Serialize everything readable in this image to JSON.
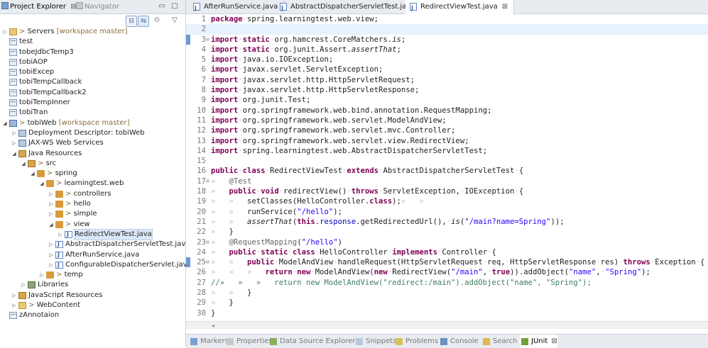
{
  "left_panel": {
    "tabs": [
      {
        "label": "Project Explorer",
        "close": "⊠",
        "active": true
      },
      {
        "label": "Navigator",
        "active": false
      }
    ],
    "tree": [
      {
        "indent": 0,
        "twisty": "▷",
        "icon": "server-icon",
        "prefix": "> ",
        "label": "Servers",
        "deco": "[workspace master]"
      },
      {
        "indent": 0,
        "twisty": "",
        "icon": "project-icon",
        "label": "test"
      },
      {
        "indent": 0,
        "twisty": "",
        "icon": "project-icon",
        "label": "tobeJdbcTemp3"
      },
      {
        "indent": 0,
        "twisty": "",
        "icon": "project-icon",
        "label": "tobiAOP"
      },
      {
        "indent": 0,
        "twisty": "",
        "icon": "project-icon",
        "label": "tobiExcep"
      },
      {
        "indent": 0,
        "twisty": "",
        "icon": "project-icon",
        "label": "tobiTempCallback"
      },
      {
        "indent": 0,
        "twisty": "",
        "icon": "project-icon",
        "label": "tobiTempCallback2"
      },
      {
        "indent": 0,
        "twisty": "",
        "icon": "project-icon",
        "label": "tobiTempInner"
      },
      {
        "indent": 0,
        "twisty": "",
        "icon": "project-icon",
        "label": "tobiTran"
      },
      {
        "indent": 0,
        "twisty": "◢",
        "icon": "web-project-icon",
        "prefix": "> ",
        "label": "tobiWeb",
        "deco": "[workspace master]"
      },
      {
        "indent": 1,
        "twisty": "▷",
        "icon": "deployment-descriptor-icon",
        "label": "Deployment Descriptor: tobiWeb"
      },
      {
        "indent": 1,
        "twisty": "▷",
        "icon": "web-services-icon",
        "label": "JAX-WS Web Services"
      },
      {
        "indent": 1,
        "twisty": "◢",
        "icon": "java-resources-icon",
        "label": "Java Resources"
      },
      {
        "indent": 2,
        "twisty": "◢",
        "icon": "source-folder-icon",
        "prefix": "> ",
        "label": "src"
      },
      {
        "indent": 3,
        "twisty": "◢",
        "icon": "package-icon",
        "prefix": "> ",
        "label": "spring"
      },
      {
        "indent": 4,
        "twisty": "◢",
        "icon": "package-icon",
        "prefix": "> ",
        "label": "learningtest.web"
      },
      {
        "indent": 5,
        "twisty": "▷",
        "icon": "package-icon",
        "prefix": "> ",
        "label": "controllers"
      },
      {
        "indent": 5,
        "twisty": "▷",
        "icon": "package-icon",
        "prefix": "> ",
        "label": "hello"
      },
      {
        "indent": 5,
        "twisty": "▷",
        "icon": "package-icon",
        "prefix": "> ",
        "label": "simple"
      },
      {
        "indent": 5,
        "twisty": "◢",
        "icon": "package-icon",
        "prefix": "> ",
        "label": "view"
      },
      {
        "indent": 6,
        "twisty": "▷",
        "icon": "java-file-icon",
        "prefix": "",
        "label": "RedirectViewTest.java",
        "selected": true
      },
      {
        "indent": 5,
        "twisty": "▷",
        "icon": "java-file-icon",
        "label": "AbstractDispatcherServletTest.java"
      },
      {
        "indent": 5,
        "twisty": "▷",
        "icon": "java-file-icon",
        "label": "AfterRunService.java"
      },
      {
        "indent": 5,
        "twisty": "▷",
        "icon": "java-file-icon",
        "label": "ConfigurableDispatcherServlet.java"
      },
      {
        "indent": 4,
        "twisty": "▷",
        "icon": "package-icon",
        "prefix": "> ",
        "label": "temp"
      },
      {
        "indent": 2,
        "twisty": "▷",
        "icon": "libraries-icon",
        "label": "Libraries"
      },
      {
        "indent": 1,
        "twisty": "▷",
        "icon": "javascript-resources-icon",
        "label": "JavaScript Resources"
      },
      {
        "indent": 1,
        "twisty": "▷",
        "icon": "web-content-icon",
        "prefix": "> ",
        "label": "WebContent"
      },
      {
        "indent": 0,
        "twisty": "",
        "icon": "project-icon",
        "label": "zAnnotaion"
      }
    ]
  },
  "editor": {
    "tabs": [
      {
        "label": "AfterRunService.java",
        "active": false
      },
      {
        "label": "AbstractDispatcherServletTest.java",
        "active": false
      },
      {
        "label": "RedirectViewTest.java",
        "active": true,
        "close": "⊠"
      }
    ],
    "lines": [
      {
        "n": "1",
        "tokens": [
          [
            "kw",
            "package"
          ],
          [
            "ws",
            "·"
          ],
          [
            "",
            "spring.learningtest.web.view;"
          ]
        ]
      },
      {
        "n": "2",
        "tokens": [],
        "current": true
      },
      {
        "n": "3",
        "fold": true,
        "marker": true,
        "tokens": [
          [
            "kw",
            "import"
          ],
          [
            "ws",
            "·"
          ],
          [
            "kw",
            "static"
          ],
          [
            "ws",
            "·"
          ],
          [
            "",
            "org.hamcrest.CoreMatchers."
          ],
          [
            "it",
            "is"
          ],
          [
            "",
            ";"
          ]
        ]
      },
      {
        "n": "4",
        "tokens": [
          [
            "kw",
            "import"
          ],
          [
            "ws",
            "·"
          ],
          [
            "kw",
            "static"
          ],
          [
            "ws",
            "·"
          ],
          [
            "",
            "org.junit.Assert."
          ],
          [
            "it",
            "assertThat"
          ],
          [
            "",
            ";"
          ]
        ]
      },
      {
        "n": "5",
        "tokens": [
          [
            "kw",
            "import"
          ],
          [
            "ws",
            "·"
          ],
          [
            "",
            "java.io.IOException;"
          ]
        ]
      },
      {
        "n": "6",
        "tokens": [
          [
            "kw",
            "import"
          ],
          [
            "ws",
            "·"
          ],
          [
            "",
            "javax.servlet.ServletException;"
          ]
        ]
      },
      {
        "n": "7",
        "tokens": [
          [
            "kw",
            "import"
          ],
          [
            "ws",
            "·"
          ],
          [
            "",
            "javax.servlet.http.HttpServletRequest;"
          ]
        ]
      },
      {
        "n": "8",
        "tokens": [
          [
            "kw",
            "import"
          ],
          [
            "ws",
            "·"
          ],
          [
            "",
            "javax.servlet.http.HttpServletResponse;"
          ]
        ]
      },
      {
        "n": "9",
        "tokens": [
          [
            "kw",
            "import"
          ],
          [
            "ws",
            "·"
          ],
          [
            "",
            "org.junit.Test;"
          ]
        ]
      },
      {
        "n": "10",
        "tokens": [
          [
            "kw",
            "import"
          ],
          [
            "ws",
            "·"
          ],
          [
            "",
            "org.springframework.web.bind.annotation.RequestMapping;"
          ]
        ]
      },
      {
        "n": "11",
        "tokens": [
          [
            "kw",
            "import"
          ],
          [
            "ws",
            "·"
          ],
          [
            "",
            "org.springframework.web.servlet.ModelAndView;"
          ]
        ]
      },
      {
        "n": "12",
        "tokens": [
          [
            "kw",
            "import"
          ],
          [
            "ws",
            "·"
          ],
          [
            "",
            "org.springframework.web.servlet.mvc.Controller;"
          ]
        ]
      },
      {
        "n": "13",
        "tokens": [
          [
            "kw",
            "import"
          ],
          [
            "ws",
            "·"
          ],
          [
            "",
            "org.springframework.web.servlet.view.RedirectView;"
          ]
        ]
      },
      {
        "n": "14",
        "tokens": [
          [
            "kw",
            "import"
          ],
          [
            "ws",
            "·"
          ],
          [
            "",
            "spring.learningtest.web.AbstractDispatcherServletTest;"
          ]
        ]
      },
      {
        "n": "15",
        "tokens": []
      },
      {
        "n": "16",
        "tokens": [
          [
            "kw",
            "public"
          ],
          [
            "ws",
            "·"
          ],
          [
            "kw",
            "class"
          ],
          [
            "ws",
            "·"
          ],
          [
            "",
            "RedirectViewTest"
          ],
          [
            "ws",
            "·"
          ],
          [
            "kw",
            "extends"
          ],
          [
            "ws",
            "·"
          ],
          [
            "",
            "AbstractDispatcherServletTest"
          ],
          [
            "ws",
            "·"
          ],
          [
            "",
            "{"
          ]
        ]
      },
      {
        "n": "17",
        "fold": true,
        "tokens": [
          [
            "ws",
            "»   "
          ],
          [
            "an",
            "@Test"
          ]
        ]
      },
      {
        "n": "18",
        "tokens": [
          [
            "ws",
            "»   "
          ],
          [
            "kw",
            "public"
          ],
          [
            "ws",
            "·"
          ],
          [
            "kw",
            "void"
          ],
          [
            "ws",
            "·"
          ],
          [
            "",
            "redirectView()"
          ],
          [
            "ws",
            "·"
          ],
          [
            "kw",
            "throws"
          ],
          [
            "ws",
            "·"
          ],
          [
            "",
            "ServletException,"
          ],
          [
            "ws",
            "·"
          ],
          [
            "",
            "IOException"
          ],
          [
            "ws",
            "·"
          ],
          [
            "",
            "{"
          ]
        ]
      },
      {
        "n": "19",
        "tokens": [
          [
            "ws",
            "»   »   "
          ],
          [
            "",
            "setClasses(HelloController."
          ],
          [
            "kw",
            "class"
          ],
          [
            "",
            ");"
          ],
          [
            "ws",
            "»   »"
          ]
        ]
      },
      {
        "n": "20",
        "tokens": [
          [
            "ws",
            "»   »   "
          ],
          [
            "",
            "runService("
          ],
          [
            "st",
            "\"/hello\""
          ],
          [
            "",
            ");"
          ]
        ]
      },
      {
        "n": "21",
        "tokens": [
          [
            "ws",
            "»   »   "
          ],
          [
            "it",
            "assertThat"
          ],
          [
            "",
            "("
          ],
          [
            "kw",
            "this"
          ],
          [
            "",
            "."
          ],
          [
            "fd",
            "response"
          ],
          [
            "",
            ".getRedirectedUrl(),"
          ],
          [
            "ws",
            "·"
          ],
          [
            "it",
            "is"
          ],
          [
            "",
            "("
          ],
          [
            "st",
            "\"/main?name=Spring\""
          ],
          [
            "",
            "));"
          ]
        ]
      },
      {
        "n": "22",
        "tokens": [
          [
            "ws",
            "»   "
          ],
          [
            "",
            "}"
          ]
        ]
      },
      {
        "n": "23",
        "fold": true,
        "tokens": [
          [
            "ws",
            "»   "
          ],
          [
            "an",
            "@RequestMapping"
          ],
          [
            "",
            "("
          ],
          [
            "st",
            "\"/hello\""
          ],
          [
            "",
            ")"
          ]
        ]
      },
      {
        "n": "24",
        "tokens": [
          [
            "ws",
            "»   "
          ],
          [
            "kw",
            "public"
          ],
          [
            "ws",
            "·"
          ],
          [
            "kw",
            "static"
          ],
          [
            "ws",
            "·"
          ],
          [
            "kw",
            "class"
          ],
          [
            "ws",
            "·"
          ],
          [
            "",
            "HelloController"
          ],
          [
            "ws",
            "·"
          ],
          [
            "kw",
            "implements"
          ],
          [
            "ws",
            "·"
          ],
          [
            "",
            "Controller"
          ],
          [
            "ws",
            "·"
          ],
          [
            "",
            "{"
          ]
        ]
      },
      {
        "n": "25",
        "fold": true,
        "marker": true,
        "tokens": [
          [
            "ws",
            "»   »   "
          ],
          [
            "kw",
            "public"
          ],
          [
            "ws",
            "·"
          ],
          [
            "",
            "ModelAndView"
          ],
          [
            "ws",
            "·"
          ],
          [
            "",
            "handleRequest(HttpServletRequest"
          ],
          [
            "ws",
            "·"
          ],
          [
            "",
            "req,"
          ],
          [
            "ws",
            "·"
          ],
          [
            "",
            "HttpServletResponse"
          ],
          [
            "ws",
            "·"
          ],
          [
            "",
            "res)"
          ],
          [
            "ws",
            "·"
          ],
          [
            "kw",
            "throws"
          ],
          [
            "ws",
            "·"
          ],
          [
            "",
            "Exception"
          ],
          [
            "ws",
            "·"
          ],
          [
            "",
            "{"
          ]
        ]
      },
      {
        "n": "26",
        "tokens": [
          [
            "ws",
            "»   »   »   "
          ],
          [
            "kw",
            "return"
          ],
          [
            "ws",
            "·"
          ],
          [
            "kw",
            "new"
          ],
          [
            "ws",
            "·"
          ],
          [
            "",
            "ModelAndView("
          ],
          [
            "kw",
            "new"
          ],
          [
            "ws",
            "·"
          ],
          [
            "",
            "RedirectView("
          ],
          [
            "st",
            "\"/main\""
          ],
          [
            "",
            ","
          ],
          [
            "ws",
            "·"
          ],
          [
            "kw",
            "true"
          ],
          [
            "",
            "))"
          ],
          [
            "",
            ".addObject("
          ],
          [
            "st",
            "\"name\""
          ],
          [
            "",
            ","
          ],
          [
            "ws",
            "·"
          ],
          [
            "st",
            "\"Spring\""
          ],
          [
            "",
            ");"
          ]
        ]
      },
      {
        "n": "27",
        "tokens": [
          [
            "cm",
            "//»   »   »   return new ModelAndView(\"redirect:/main\").addObject(\"name\", \"Spring\");"
          ]
        ]
      },
      {
        "n": "28",
        "tokens": [
          [
            "ws",
            "»   »   "
          ],
          [
            "",
            "}"
          ]
        ]
      },
      {
        "n": "29",
        "tokens": [
          [
            "ws",
            "»   "
          ],
          [
            "",
            "}"
          ]
        ]
      },
      {
        "n": "30",
        "tokens": [
          [
            "",
            "}"
          ]
        ]
      }
    ]
  },
  "bottom_tabs": [
    {
      "label": "Markers",
      "icon": "markers-icon"
    },
    {
      "label": "Properties",
      "icon": "properties-icon"
    },
    {
      "label": "Data Source Explorer",
      "icon": "data-source-icon"
    },
    {
      "label": "Snippets",
      "icon": "snippets-icon"
    },
    {
      "label": "Problems",
      "icon": "problems-icon"
    },
    {
      "label": "Console",
      "icon": "console-icon"
    },
    {
      "label": "Search",
      "icon": "search-icon"
    },
    {
      "label": "JUnit",
      "icon": "junit-icon",
      "active": true,
      "close": "⊠"
    }
  ]
}
